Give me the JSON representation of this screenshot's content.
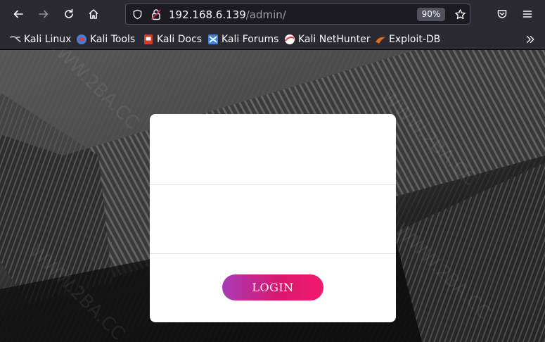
{
  "browser": {
    "url_host": "192.168.6.139",
    "url_path": "/admin/",
    "zoom": "90%"
  },
  "bookmarks": [
    {
      "label": "Kali Linux",
      "icon": "kali-dragon-icon",
      "color": "#d0d0d0"
    },
    {
      "label": "Kali Tools",
      "icon": "kali-tools-icon",
      "color": "#4a7bd4"
    },
    {
      "label": "Kali Docs",
      "icon": "kali-docs-icon",
      "color": "#d23a2a"
    },
    {
      "label": "Kali Forums",
      "icon": "kali-forums-icon",
      "color": "#3b86d8"
    },
    {
      "label": "Kali NetHunter",
      "icon": "kali-nethunter-icon",
      "color": "#e04040"
    },
    {
      "label": "Exploit-DB",
      "icon": "exploit-db-icon",
      "color": "#e07020"
    }
  ],
  "login": {
    "username_value": "",
    "password_value": "",
    "button_label": "LOGIN"
  },
  "watermark": "WWW.2BA.CC"
}
